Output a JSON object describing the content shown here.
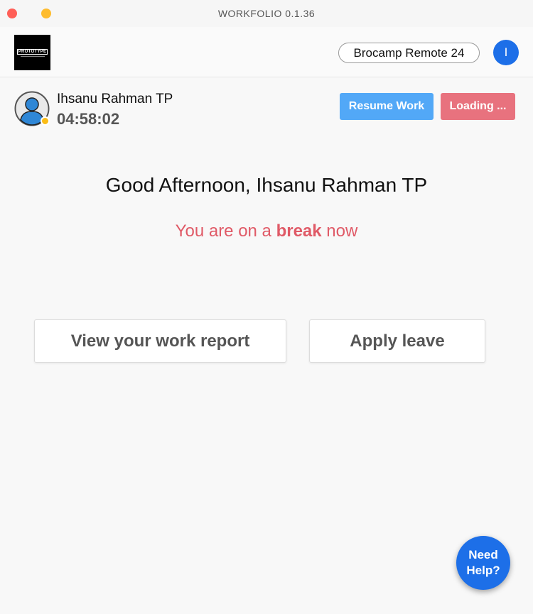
{
  "window": {
    "title": "WORKFOLIO 0.1.36"
  },
  "header": {
    "logo_text": "PROTOTYPE",
    "workspace_name": "Brocamp Remote 24",
    "profile_initial": "I"
  },
  "user": {
    "name": "Ihsanu Rahman TP",
    "timer": "04:58:02",
    "status_color": "#fbbc15"
  },
  "actions": {
    "resume_label": "Resume Work",
    "loading_label": "Loading ..."
  },
  "main": {
    "greeting": "Good Afternoon, Ihsanu Rahman TP",
    "break_prefix": "You are on a ",
    "break_word": "break",
    "break_suffix": " now",
    "report_label": "View your work report",
    "leave_label": "Apply leave"
  },
  "help": {
    "line1": "Need",
    "line2": "Help?"
  },
  "colors": {
    "accent_blue": "#1d6fe8",
    "resume_blue": "#52a8f7",
    "loading_red": "#e8727e",
    "break_red": "#e05a67"
  },
  "icons": {
    "close": "close-traffic-light",
    "minimize": "minimize-traffic-light",
    "user": "user-avatar-icon"
  }
}
